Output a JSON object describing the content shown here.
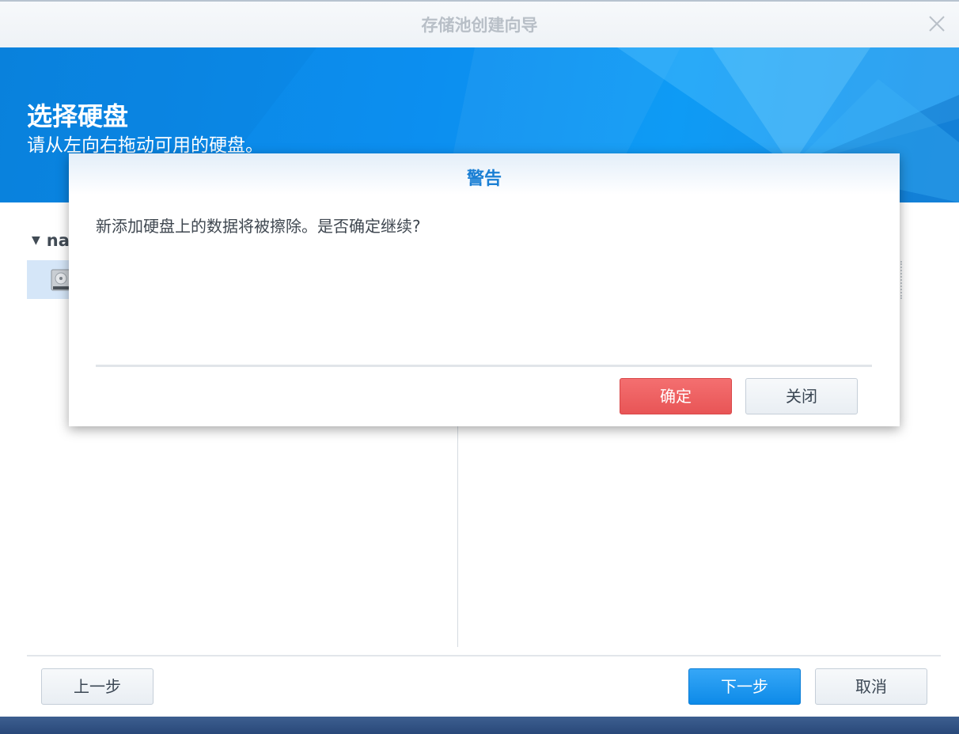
{
  "window": {
    "title": "存储池创建向导"
  },
  "banner": {
    "title": "选择硬盘",
    "subtitle": "请从左向右拖动可用的硬盘。"
  },
  "disk_list": {
    "group_label": "na",
    "icons": [
      "caret-down-icon",
      "hard-disk-icon"
    ]
  },
  "footer": {
    "prev_label": "上一步",
    "next_label": "下一步",
    "cancel_label": "取消"
  },
  "dialog": {
    "title": "警告",
    "message": "新添加硬盘上的数据将被擦除。是否确定继续?",
    "confirm_label": "确定",
    "close_label": "关闭"
  },
  "colors": {
    "accent": "#0d8ae8",
    "banner": "#0c8ff0",
    "danger": "#e85556",
    "dialog_title": "#1a7fd4"
  }
}
